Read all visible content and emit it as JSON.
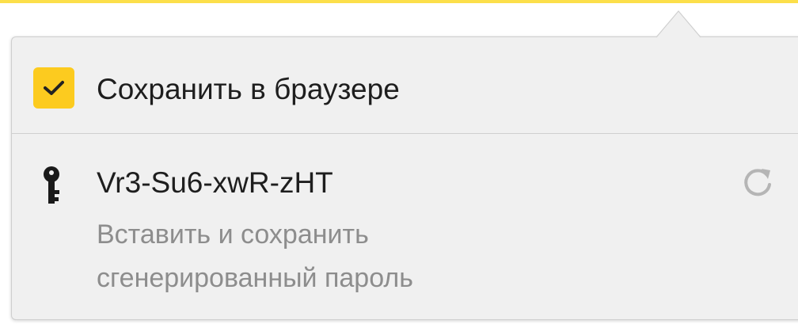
{
  "popup": {
    "save_in_browser": {
      "label": "Сохранить в браузере",
      "checked": true
    },
    "generated_password": {
      "value": "Vr3-Su6-xwR-zHT",
      "hint_line1": "Вставить и сохранить",
      "hint_line2": "сгенерированный пароль"
    },
    "icons": {
      "checkbox": "checkmark-icon",
      "key": "key-icon",
      "regenerate": "refresh-icon"
    }
  },
  "colors": {
    "accent_yellow": "#fccb1f",
    "top_bar_yellow": "#fcdf4a",
    "popup_bg": "#f0f0f0",
    "text_primary": "#1e1e1e",
    "text_secondary": "#8d8d8d",
    "icon_grey": "#b5b5b5"
  }
}
